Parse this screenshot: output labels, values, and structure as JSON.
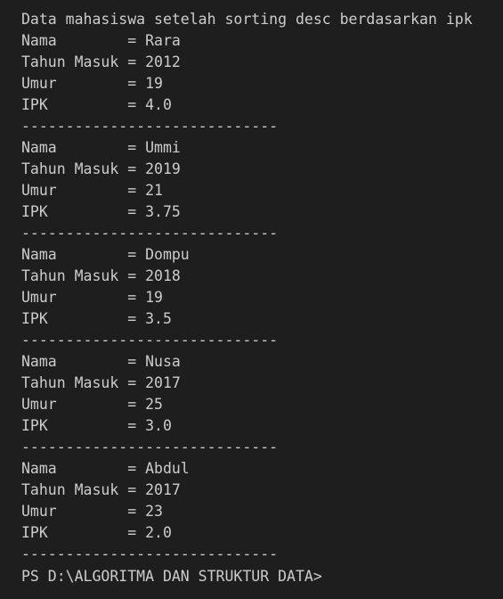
{
  "terminal": {
    "top_separator": "-----------------------------",
    "heading": "Data mahasiswa setelah sorting desc berdasarkan ipk",
    "separator": "-----------------------------",
    "prompt": "PS D:\\ALGORITMA DAN STRUKTUR DATA>",
    "records": [
      {
        "nama": "Nama        = Rara",
        "tahun": "Tahun Masuk = 2012",
        "umur": "Umur        = 19",
        "ipk": "IPK         = 4.0"
      },
      {
        "nama": "Nama        = Ummi",
        "tahun": "Tahun Masuk = 2019",
        "umur": "Umur        = 21",
        "ipk": "IPK         = 3.75"
      },
      {
        "nama": "Nama        = Dompu",
        "tahun": "Tahun Masuk = 2018",
        "umur": "Umur        = 19",
        "ipk": "IPK         = 3.5"
      },
      {
        "nama": "Nama        = Nusa",
        "tahun": "Tahun Masuk = 2017",
        "umur": "Umur        = 25",
        "ipk": "IPK         = 3.0"
      },
      {
        "nama": "Nama        = Abdul",
        "tahun": "Tahun Masuk = 2017",
        "umur": "Umur        = 23",
        "ipk": "IPK         = 2.0"
      }
    ]
  }
}
